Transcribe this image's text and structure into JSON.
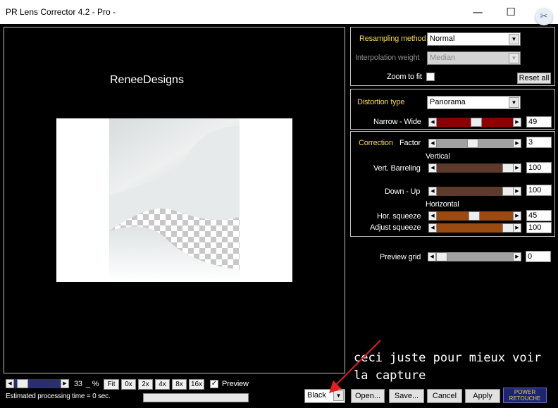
{
  "window": {
    "title": "PR Lens Corrector 4.2 - Pro -",
    "minimize_icon": "minimize-icon",
    "maximize_icon": "maximize-icon",
    "close_icon": "close-icon",
    "overlay_icon": "screen-capture-icon"
  },
  "preview": {
    "watermark": "ReneeDesigns"
  },
  "resampling": {
    "method_label": "Resampling method",
    "method_value": "Normal",
    "weight_label": "Interpolation weight",
    "weight_value": "Median",
    "zoom_label": "Zoom to fit",
    "zoom_checked": false,
    "reset_label": "Reset all"
  },
  "distortion": {
    "type_label": "Distortion type",
    "type_value": "Panorama",
    "narrow_label": "Narrow - Wide",
    "narrow_value": "49"
  },
  "correction": {
    "title": "Correction",
    "factor_label": "Factor",
    "factor_value": "3",
    "vertical_heading": "Vertical",
    "vert_barreling_label": "Vert. Barreling",
    "vert_barreling_value": "100",
    "down_up_label": "Down - Up",
    "down_up_value": "100",
    "horizontal_heading": "Horizontal",
    "hor_squeeze_label": "Hor. squeeze",
    "hor_squeeze_value": "45",
    "adjust_squeeze_label": "Adjust squeeze",
    "adjust_squeeze_value": "100"
  },
  "grid": {
    "label": "Preview grid",
    "value": "0"
  },
  "zoom": {
    "percent": "33",
    "unit": "_ %",
    "buttons": [
      "Fit",
      "0x",
      "2x",
      "4x",
      "8x",
      "16x"
    ],
    "preview_label": "Preview",
    "preview_checked": true
  },
  "status": {
    "estimate": "Estimated processing time =  0 sec."
  },
  "background": {
    "value": "Black"
  },
  "actions": {
    "open": "Open...",
    "save": "Save...",
    "cancel": "Cancel",
    "apply": "Apply"
  },
  "logo": {
    "line1": "POWER",
    "line2": "RETOUCHE"
  },
  "annotation": {
    "line1": "ceci juste pour mieux voir",
    "line2": "la capture"
  },
  "colors": {
    "label_yellow": "#f7d757",
    "slider_red": "#8b0000",
    "slider_brown": "#5e3a2c",
    "slider_orange": "#9b4a12",
    "slider_grey": "#a0a0a0",
    "slider_navy": "#2a2f6e",
    "arrow_red": "#e02020"
  }
}
